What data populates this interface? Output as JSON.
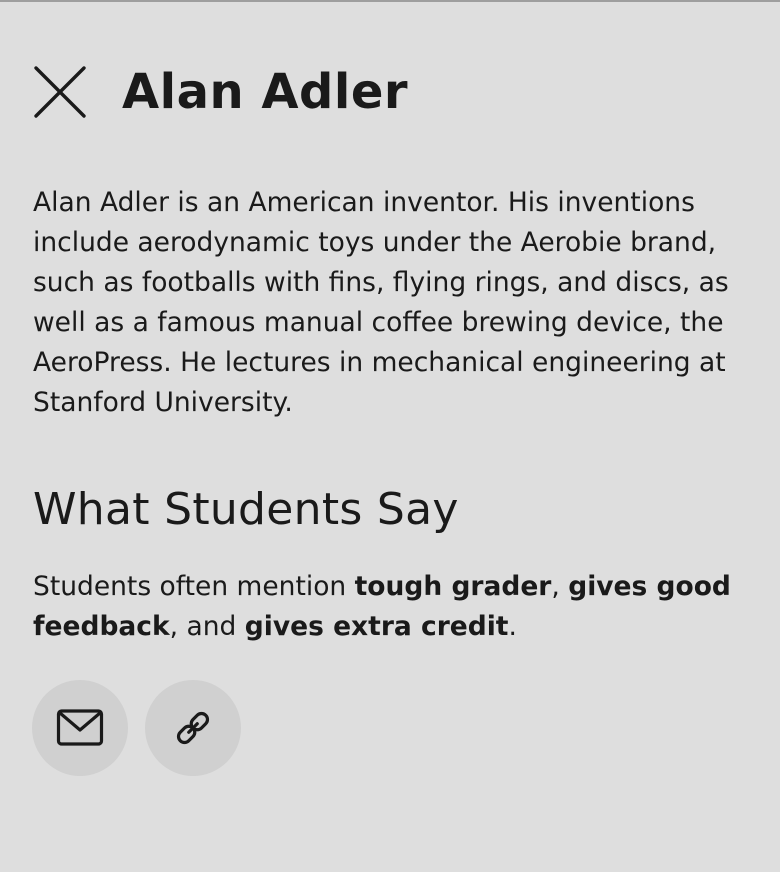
{
  "header": {
    "title": "Alan Adler",
    "close_icon": "close-icon"
  },
  "bio": {
    "text": "Alan Adler is an American inventor. His inventions include aerodynamic toys under the Aerobie brand, such as footballs with fins, flying rings, and discs, as well as a famous manual coffee brewing device, the AeroPress. He lectures in mechanical engineering at Stanford University."
  },
  "reviews": {
    "heading": "What Students Say",
    "prefix": "Students often mention ",
    "tags": [
      "tough grader",
      "gives good feedback",
      "gives extra credit"
    ],
    "sep_1": ", ",
    "sep_2": ", and ",
    "suffix": "."
  },
  "actions": [
    {
      "icon": "mail-icon"
    },
    {
      "icon": "link-icon"
    }
  ],
  "colors": {
    "background": "#dedede",
    "button_background": "#d0d0d0",
    "text": "#1a1a1a",
    "top_border": "#9e9e9e"
  }
}
